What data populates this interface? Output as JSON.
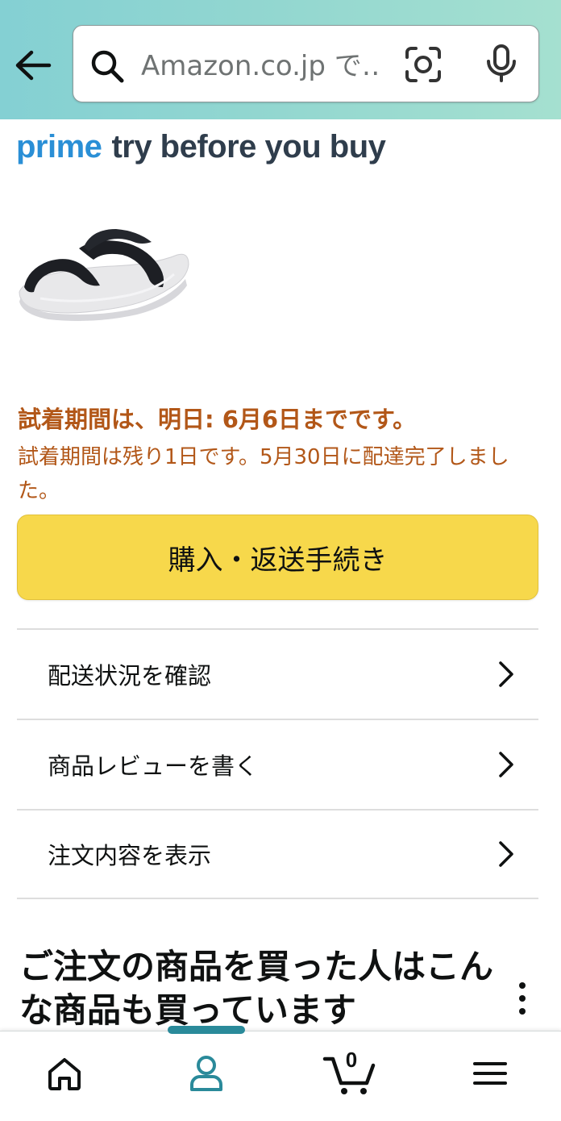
{
  "colors": {
    "header_gradient_start": "#84d0d3",
    "header_gradient_end": "#a5e0d0",
    "prime_blue": "#2a8fd6",
    "trial_orange": "#b25718",
    "button_yellow": "#f7d84b",
    "active_nav": "#2a8a9a"
  },
  "header": {
    "back_icon": "arrow-left-icon",
    "search": {
      "placeholder": "Amazon.co.jp で…",
      "search_icon": "search-icon",
      "camera_icon": "camera-lens-icon",
      "mic_icon": "microphone-icon"
    }
  },
  "banner": {
    "prime": "prime",
    "tagline": "try before you buy"
  },
  "product": {
    "image_icon": "sandal-product-image"
  },
  "trial": {
    "heading": "試着期間は、明日: 6月6日までです。",
    "subtext": "試着期間は残り1日です。5月30日に配達完了しました。"
  },
  "primary_button": {
    "label": "購入・返送手続き"
  },
  "actions": [
    {
      "label": "配送状況を確認"
    },
    {
      "label": "商品レビューを書く"
    },
    {
      "label": "注文内容を表示"
    }
  ],
  "recommendations": {
    "heading": "ご注文の商品を買った人はこんな商品も買っています"
  },
  "bottom_nav": {
    "items": [
      {
        "icon": "home-icon"
      },
      {
        "icon": "account-icon",
        "active": true
      },
      {
        "icon": "cart-icon",
        "count": "0"
      },
      {
        "icon": "menu-icon"
      }
    ]
  }
}
